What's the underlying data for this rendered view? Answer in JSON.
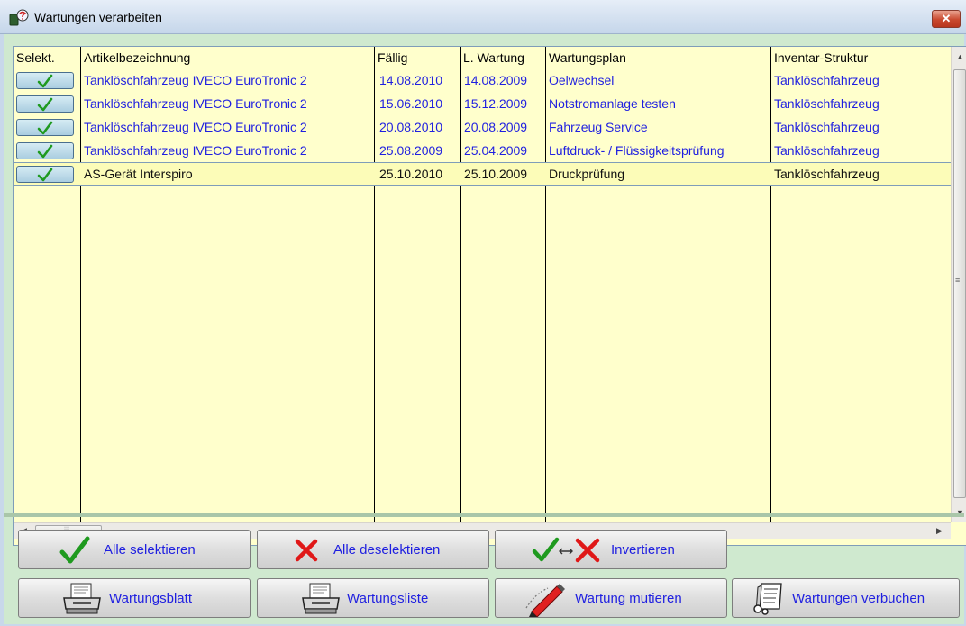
{
  "window": {
    "title": "Wartungen verarbeiten",
    "close_label": "✕"
  },
  "grid": {
    "columns": [
      "Selekt.",
      "Artikelbezeichnung",
      "Fällig",
      "L. Wartung",
      "Wartungsplan",
      "Inventar-Struktur"
    ],
    "rows": [
      {
        "selected": true,
        "artikel": "Tanklöschfahrzeug IVECO EuroTronic 2",
        "faellig": "14.08.2010",
        "l_wartung": "14.08.2009",
        "plan": "Oelwechsel",
        "struktur": "Tanklöschfahrzeug",
        "current": false
      },
      {
        "selected": true,
        "artikel": "Tanklöschfahrzeug IVECO EuroTronic 2",
        "faellig": "15.06.2010",
        "l_wartung": "15.12.2009",
        "plan": "Notstromanlage testen",
        "struktur": "Tanklöschfahrzeug",
        "current": false
      },
      {
        "selected": true,
        "artikel": "Tanklöschfahrzeug IVECO EuroTronic 2",
        "faellig": "20.08.2010",
        "l_wartung": "20.08.2009",
        "plan": "Fahrzeug Service",
        "struktur": "Tanklöschfahrzeug",
        "current": false
      },
      {
        "selected": true,
        "artikel": "Tanklöschfahrzeug IVECO EuroTronic 2",
        "faellig": "25.08.2009",
        "l_wartung": "25.04.2009",
        "plan": "Luftdruck- / Flüssigkeitsprüfung",
        "struktur": "Tanklöschfahrzeug",
        "current": false
      },
      {
        "selected": true,
        "artikel": "AS-Gerät Interspiro",
        "faellig": "25.10.2010",
        "l_wartung": "25.10.2009",
        "plan": "Druckprüfung",
        "struktur": "Tanklöschfahrzeug",
        "current": true
      }
    ]
  },
  "buttons": {
    "alle_selektieren": "Alle selektieren",
    "alle_deselektieren": "Alle deselektieren",
    "invertieren": "Invertieren",
    "wartungsblatt": "Wartungsblatt",
    "wartungsliste": "Wartungsliste",
    "wartung_mutieren": "Wartung mutieren",
    "wartungen_verbuchen": "Wartungen verbuchen"
  },
  "icons": {
    "check": "check-icon",
    "cross": "cross-icon",
    "invert": "invert-icon",
    "printer": "printer-icon",
    "edit": "edit-pen-icon",
    "book": "book-icon"
  },
  "colors": {
    "text_blue": "#1f1fe0",
    "check_green": "#1f9a1f",
    "cross_red": "#e01818",
    "grid_bg": "#ffffcc",
    "panel_bg": "#cfe9cf"
  }
}
